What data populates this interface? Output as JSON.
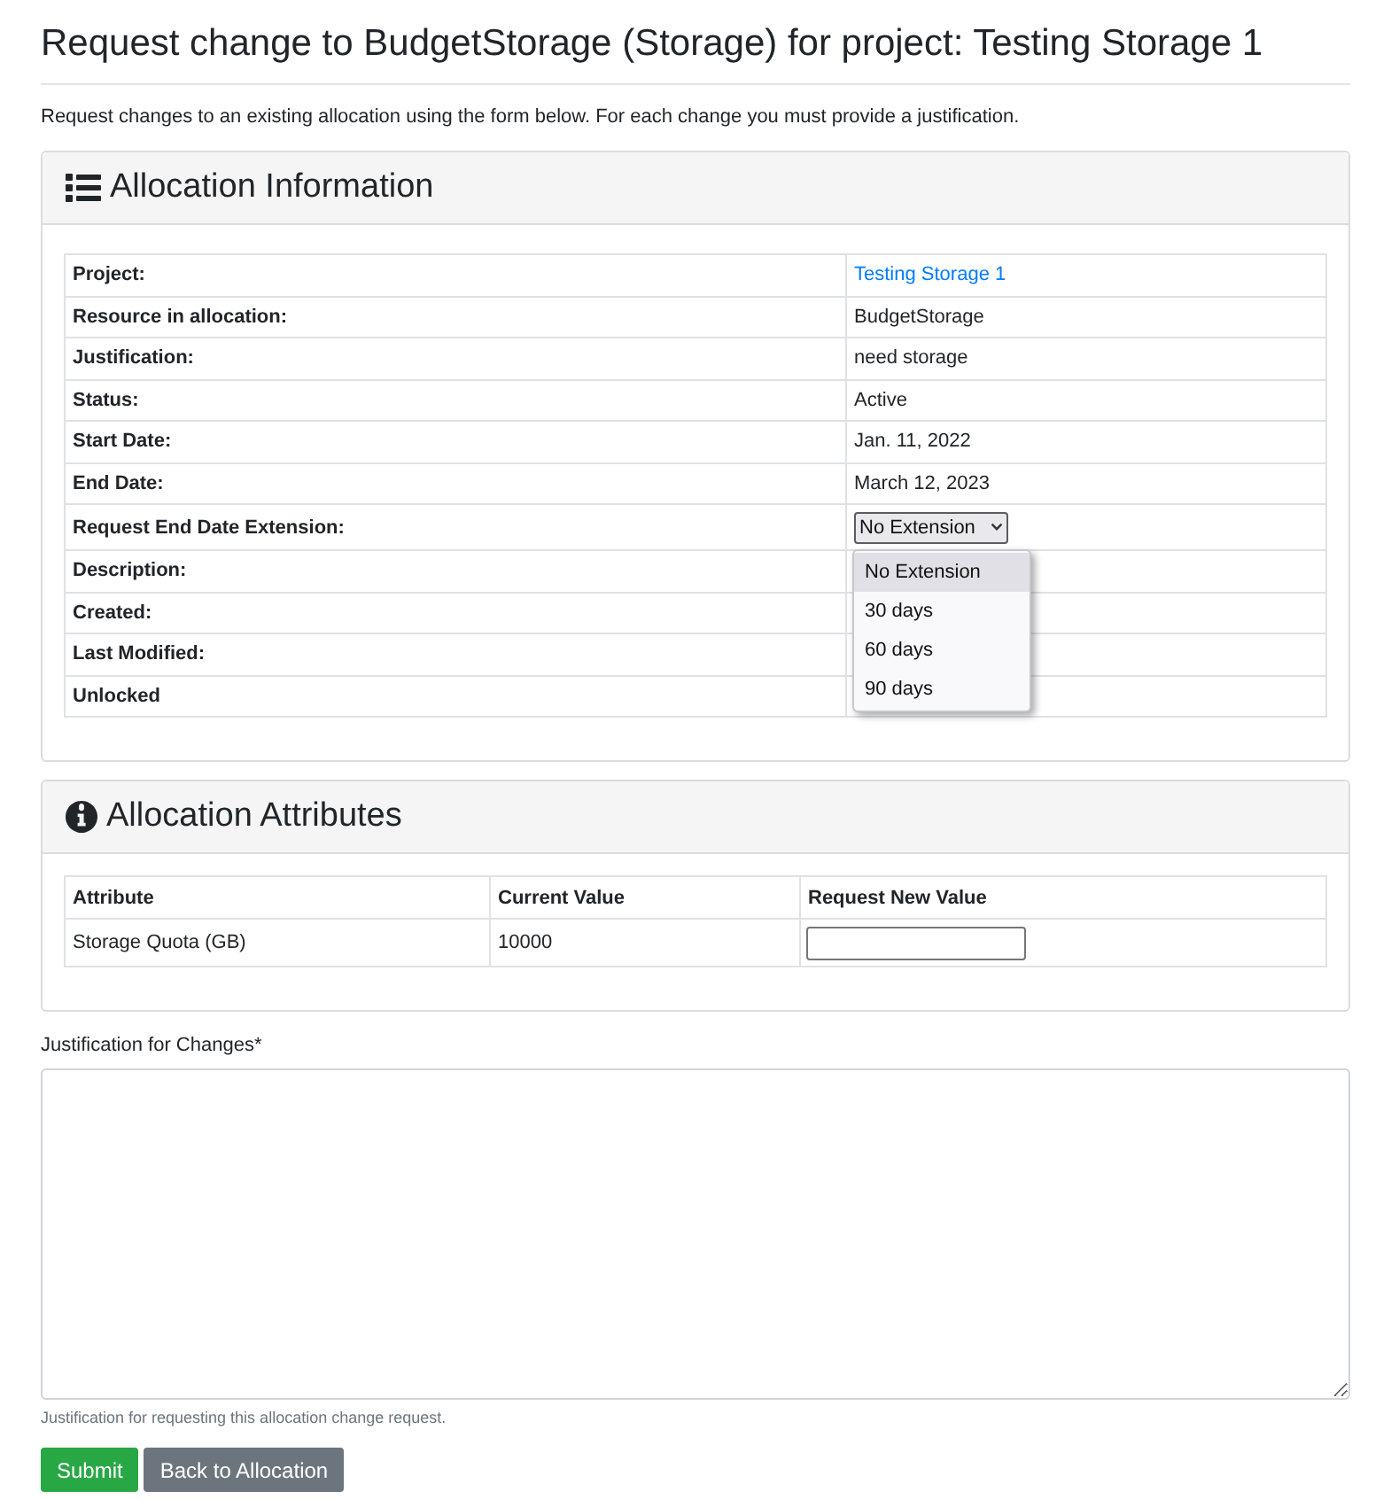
{
  "page": {
    "title": "Request change to BudgetStorage (Storage) for project: Testing Storage 1",
    "intro": "Request changes to an existing allocation using the form below. For each change you must provide a justification."
  },
  "allocation_information": {
    "title": "Allocation Information",
    "rows": [
      {
        "label": "Project:",
        "kind": "link",
        "value": "Testing Storage 1"
      },
      {
        "label": "Resource in allocation:",
        "kind": "text",
        "value": "BudgetStorage"
      },
      {
        "label": "Justification:",
        "kind": "text",
        "value": "need storage"
      },
      {
        "label": "Status:",
        "kind": "text",
        "value": "Active"
      },
      {
        "label": "Start Date:",
        "kind": "text",
        "value": "Jan. 11, 2022"
      },
      {
        "label": "End Date:",
        "kind": "text",
        "value": "March 12, 2023"
      },
      {
        "label": "Request End Date Extension:",
        "kind": "select",
        "value": "No Extension",
        "expanded": true,
        "options": [
          {
            "label": "No Extension",
            "selected": true
          },
          {
            "label": "30 days",
            "selected": false
          },
          {
            "label": "60 days",
            "selected": false
          },
          {
            "label": "90 days",
            "selected": false
          }
        ]
      },
      {
        "label": "Description:",
        "kind": "text"
      },
      {
        "label": "Created:",
        "kind": "text"
      },
      {
        "label": "Last Modified:",
        "kind": "text"
      },
      {
        "label": "Unlocked",
        "kind": "text"
      }
    ]
  },
  "allocation_attributes": {
    "title": "Allocation Attributes",
    "columns": [
      "Attribute",
      "Current Value",
      "Request New Value"
    ],
    "rows": [
      {
        "attribute": "Storage Quota (GB)",
        "current_value": "10000"
      }
    ]
  },
  "justification": {
    "label": "Justification for Changes*",
    "help": "Justification for requesting this allocation change request."
  },
  "buttons": [
    {
      "label": "Submit",
      "kind": "primary"
    },
    {
      "label": "Back to Allocation",
      "kind": "secondary"
    }
  ]
}
